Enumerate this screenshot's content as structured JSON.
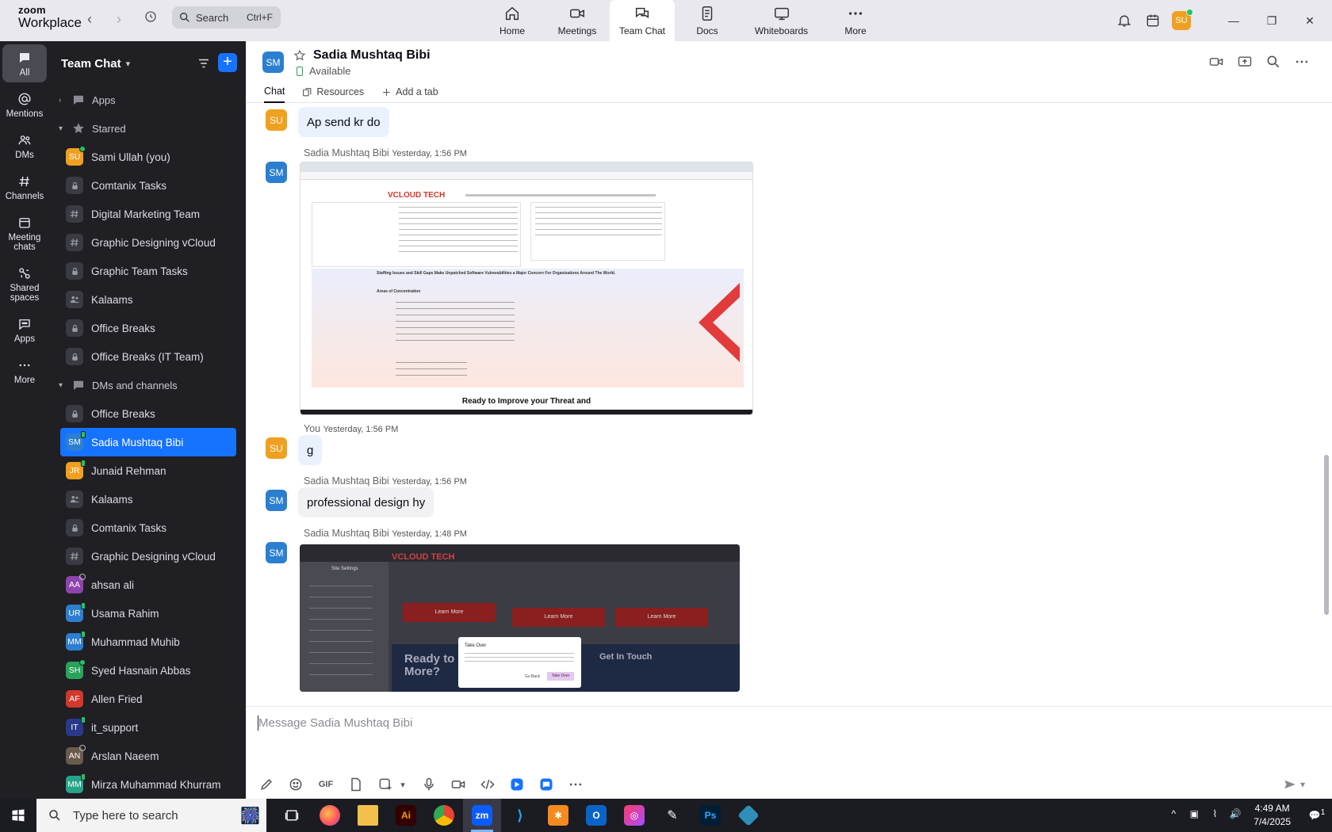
{
  "topbar": {
    "brand_top": "zoom",
    "brand_bottom": "Workplace",
    "search_placeholder": "Search",
    "search_shortcut": "Ctrl+F",
    "user_initials": "SU",
    "nav": [
      {
        "label": "Home",
        "icon": "home-icon"
      },
      {
        "label": "Meetings",
        "icon": "video-icon"
      },
      {
        "label": "Team Chat",
        "icon": "chat-icon"
      },
      {
        "label": "Docs",
        "icon": "doc-icon"
      },
      {
        "label": "Whiteboards",
        "icon": "whiteboard-icon"
      },
      {
        "label": "More",
        "icon": "more-icon"
      }
    ]
  },
  "rail": [
    {
      "label": "All",
      "icon": "chat-bubble-icon"
    },
    {
      "label": "Mentions",
      "icon": "at-icon"
    },
    {
      "label": "DMs",
      "icon": "people-icon"
    },
    {
      "label": "Channels",
      "icon": "hash-icon"
    },
    {
      "label": "Meeting chats",
      "icon": "calendar-icon"
    },
    {
      "label": "Shared spaces",
      "icon": "shared-icon"
    },
    {
      "label": "Apps",
      "icon": "apps-icon"
    },
    {
      "label": "More",
      "icon": "ellipsis-icon"
    }
  ],
  "sidebar": {
    "title": "Team Chat",
    "apps_section": "Apps",
    "starred_section": "Starred",
    "dms_section": "DMs and channels",
    "starred": [
      {
        "label": "Sami Ullah (you)",
        "initials": "SU",
        "color": "#f0a020",
        "status": "on"
      },
      {
        "label": "Comtanix Tasks",
        "glyph": "lock"
      },
      {
        "label": "Digital Marketing Team",
        "glyph": "hash"
      },
      {
        "label": "Graphic Designing vCloud",
        "glyph": "hash"
      },
      {
        "label": "Graphic Team Tasks",
        "glyph": "lock"
      },
      {
        "label": "Kalaams",
        "glyph": "people"
      },
      {
        "label": "Office Breaks",
        "glyph": "lock"
      },
      {
        "label": "Office Breaks (IT Team)",
        "glyph": "lock"
      }
    ],
    "dms": [
      {
        "label": "Office Breaks",
        "glyph": "lock"
      },
      {
        "label": "Sadia Mushtaq Bibi",
        "initials": "SM",
        "color": "#2c7fd0",
        "status": "mob",
        "selected": true
      },
      {
        "label": "Junaid Rehman",
        "initials": "JR",
        "color": "#f0a020",
        "status": "mob"
      },
      {
        "label": "Kalaams",
        "glyph": "people"
      },
      {
        "label": "Comtanix Tasks",
        "glyph": "lock"
      },
      {
        "label": "Graphic Designing vCloud",
        "glyph": "hash"
      },
      {
        "label": "ahsan ali",
        "initials": "AA",
        "color": "#8e44ad",
        "status": "off"
      },
      {
        "label": "Usama Rahim",
        "initials": "UR",
        "color": "#2c7fd0",
        "status": "mob"
      },
      {
        "label": "Muhammad Muhib",
        "initials": "MM",
        "color": "#2c7fd0",
        "status": "mob"
      },
      {
        "label": "Syed Hasnain Abbas",
        "initials": "SH",
        "color": "#27a35a",
        "status": "on"
      },
      {
        "label": "Allen Fried",
        "initials": "AF",
        "color": "#d0392b",
        "status": "none"
      },
      {
        "label": "it_support",
        "initials": "IT",
        "color": "#2a3a8a",
        "status": "mob"
      },
      {
        "label": "Arslan Naeem",
        "initials": "AN",
        "color": "#6b5b4b",
        "status": "off"
      },
      {
        "label": "Mirza Muhammad Khurram",
        "initials": "MM",
        "color": "#27a38a",
        "status": "mob"
      }
    ]
  },
  "chat": {
    "contact_initials": "SM",
    "contact_name": "Sadia Mushtaq Bibi",
    "contact_status": "Available",
    "tabs": [
      "Chat",
      "Resources",
      "Add a tab"
    ],
    "composer_placeholder": "Message Sadia Mushtaq Bibi",
    "messages": [
      {
        "sender": "",
        "initials": "SU",
        "time": "",
        "text": "Ap send kr do"
      },
      {
        "sender": "Sadia Mushtaq Bibi",
        "initials": "SM",
        "time": "Yesterday, 1:56 PM",
        "image": "website-screenshot-1"
      },
      {
        "sender": "You",
        "initials": "SU",
        "time": "Yesterday, 1:56 PM",
        "text": "g"
      },
      {
        "sender": "Sadia Mushtaq Bibi",
        "initials": "SM",
        "time": "Yesterday, 1:56 PM",
        "text": "professional design hy"
      },
      {
        "sender": "Sadia Mushtaq Bibi",
        "initials": "SM",
        "time": "Yesterday, 1:48 PM",
        "image": "website-screenshot-2"
      }
    ],
    "shot1": {
      "brand": "VCLOUD TECH",
      "heading": "Staffing Issues and Skill Gaps Make Unpatched Software Vulnerabilities a Major Concern For Organizations Around The World.",
      "areas_title": "Areas of Concentration",
      "footer": "Ready to Improve your Threat and"
    },
    "shot2": {
      "brand": "VCLOUD TECH",
      "sidebar_title": "Site Settings",
      "dialog_title": "Take Over",
      "dialog_cancel": "Go Back",
      "dialog_ok": "Take Over",
      "banner_left": "Ready to",
      "banner_left2": "More?",
      "banner_right": "Get In Touch",
      "learn": "Learn More"
    }
  },
  "taskbar": {
    "search_placeholder": "Type here to search",
    "time": "4:49 AM",
    "date": "7/4/2025",
    "notif_count": "1"
  }
}
